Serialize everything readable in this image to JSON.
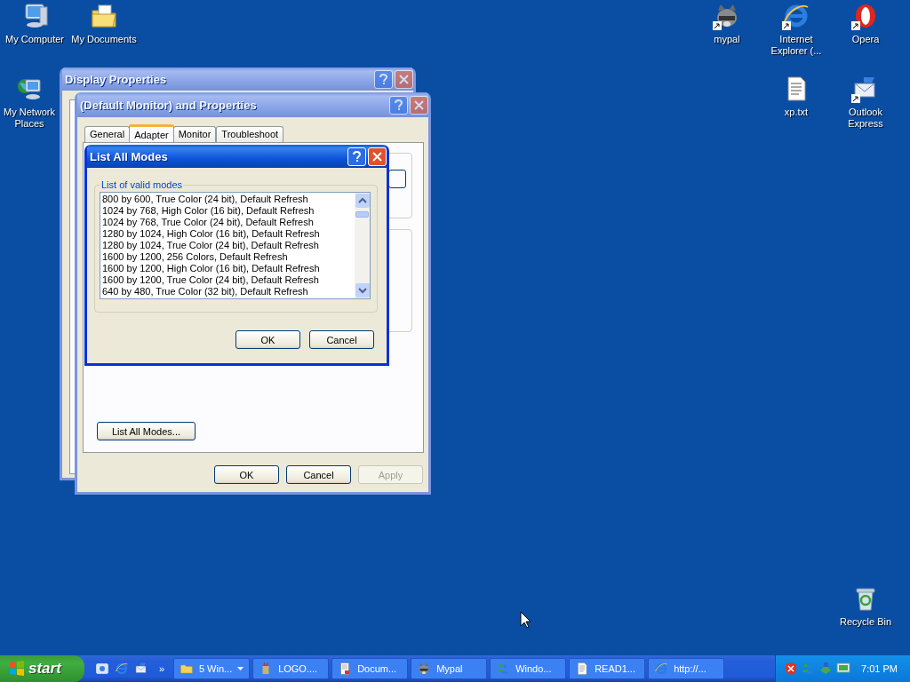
{
  "desktop_icons": [
    {
      "label": "My Computer",
      "kind": "computer",
      "shortcut": false
    },
    {
      "label": "My Documents",
      "kind": "documents",
      "shortcut": false
    },
    {
      "label": "My Network Places",
      "kind": "network",
      "shortcut": false
    },
    {
      "label": "mypal",
      "kind": "animal",
      "shortcut": true
    },
    {
      "label": "Internet Explorer (...",
      "kind": "browser",
      "shortcut": true
    },
    {
      "label": "Opera",
      "kind": "opera",
      "shortcut": true
    },
    {
      "label": "xp.txt",
      "kind": "text",
      "shortcut": false
    },
    {
      "label": "Outlook Express",
      "kind": "mail",
      "shortcut": true
    },
    {
      "label": "Recycle Bin",
      "kind": "recycle",
      "shortcut": false
    }
  ],
  "back_window": {
    "title": "Display Properties",
    "active": false
  },
  "properties_window": {
    "title": "(Default Monitor) and  Properties",
    "active": false,
    "tabs": [
      {
        "label": "General",
        "selected": false
      },
      {
        "label": "Adapter",
        "selected": true
      },
      {
        "label": "Monitor",
        "selected": false
      },
      {
        "label": "Troubleshoot",
        "selected": false
      }
    ],
    "list_modes_button": "List All Modes...",
    "buttons": [
      {
        "label": "OK",
        "disabled": false
      },
      {
        "label": "Cancel",
        "disabled": false
      },
      {
        "label": "Apply",
        "disabled": true
      }
    ]
  },
  "list_modes_dialog": {
    "title": "List All Modes",
    "active": true,
    "group_label": "List of valid modes",
    "modes": [
      {
        "label": "800 by 600, True Color (24 bit), Default Refresh",
        "selected": false
      },
      {
        "label": "1024 by 768, High Color (16 bit), Default Refresh",
        "selected": false
      },
      {
        "label": "1024 by 768, True Color (24 bit), Default Refresh",
        "selected": false
      },
      {
        "label": "1280 by 1024, High Color (16 bit), Default Refresh",
        "selected": false
      },
      {
        "label": "1280 by 1024, True Color (24 bit), Default Refresh",
        "selected": false
      },
      {
        "label": "1600 by 1200, 256 Colors, Default Refresh",
        "selected": false
      },
      {
        "label": "1600 by 1200, High Color (16 bit), Default Refresh",
        "selected": false
      },
      {
        "label": "1600 by 1200, True Color (24 bit), Default Refresh",
        "selected": false
      },
      {
        "label": "640 by 480, True Color (32 bit), Default Refresh",
        "selected": false
      }
    ],
    "buttons": [
      {
        "label": "OK",
        "disabled": false
      },
      {
        "label": "Cancel",
        "disabled": false
      }
    ]
  },
  "taskbar": {
    "start": "start",
    "quick_launch_more": "»",
    "tasks": [
      {
        "label": "5 Win...",
        "kind": "folder",
        "grouped": true,
        "selected": false
      },
      {
        "label": "LOGO....",
        "kind": "paint",
        "grouped": false,
        "selected": false
      },
      {
        "label": "Docum...",
        "kind": "document",
        "grouped": false,
        "selected": false
      },
      {
        "label": "Mypal",
        "kind": "animal",
        "grouped": false,
        "selected": false
      },
      {
        "label": "Windo...",
        "kind": "people",
        "grouped": false,
        "selected": false
      },
      {
        "label": "READ1...",
        "kind": "text",
        "grouped": false,
        "selected": false
      },
      {
        "label": "http://...",
        "kind": "browser",
        "grouped": false,
        "selected": false
      }
    ],
    "clock": "7:01 PM"
  }
}
